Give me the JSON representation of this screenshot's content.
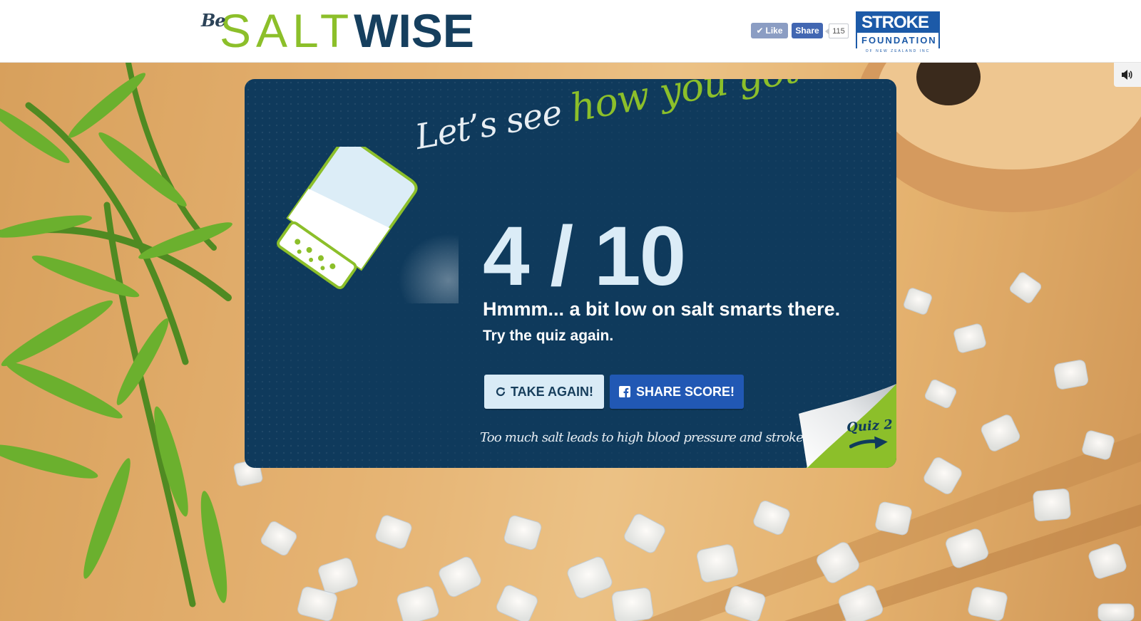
{
  "header": {
    "logo": {
      "be": "Be",
      "salt": "SALT",
      "wise": "WISE"
    },
    "facebook": {
      "like_label": "Like",
      "share_label": "Share",
      "count": "115"
    },
    "partner_logo": {
      "line1": "STROKE",
      "line2": "FOUNDATION",
      "line3": "OF NEW ZEALAND INC"
    }
  },
  "result_card": {
    "headline_part1": "Let’s see ",
    "headline_part2": "how you got on...",
    "score": "4 / 10",
    "message": "Hmmm... a bit low on salt smarts there.",
    "submessage": "Try the quiz again.",
    "take_again_label": "TAKE AGAIN!",
    "share_score_label": "SHARE SCORE!",
    "tagline": "Too much salt leads to high blood pressure and stroke",
    "next_quiz_label": "Quiz 2"
  },
  "icons": {
    "sound": "speaker-icon",
    "retry": "refresh-icon",
    "facebook": "facebook-icon",
    "like": "thumbs-up-icon",
    "next": "arrow-right-icon"
  },
  "colors": {
    "brand_green": "#8cbf2a",
    "brand_navy": "#163f5e",
    "card_bg": "#0f3a5c",
    "share_blue": "#2158b4",
    "take_again_bg": "#d9ebf6"
  }
}
